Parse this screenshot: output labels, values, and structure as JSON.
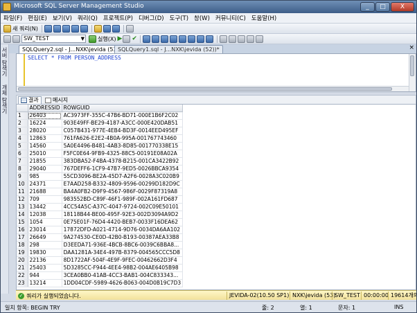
{
  "window": {
    "title": "Microsoft SQL Server Management Studio",
    "buttons": [
      "_",
      "□",
      "X"
    ]
  },
  "menu": [
    "파일(F)",
    "편집(E)",
    "보기(V)",
    "쿼리(Q)",
    "프로젝트(P)",
    "디버그(D)",
    "도구(T)",
    "창(W)",
    "커뮤니티(C)",
    "도움말(H)"
  ],
  "toolbar": {
    "new_query": "새 쿼리(N)",
    "database": "SW_TEST",
    "execute": "실행(X)"
  },
  "sidebar": {
    "tab1": "서버 탐색기",
    "tab2": "개체 탐색기"
  },
  "doc_tabs": [
    {
      "label": "SQLQuery2.sql - J...NXK\\jevida (53))*"
    },
    {
      "label": "SQLQuery1.sql - J...NXK\\jevida (52))*"
    }
  ],
  "editor": {
    "code": "SELECT * FROM PERSON_ADDRESS"
  },
  "result_tabs": {
    "results": "결과",
    "messages": "메시지"
  },
  "grid": {
    "columns": [
      "ADDRESSID",
      "ROWGUID"
    ],
    "rows": [
      [
        "1",
        "26403",
        "AC3973FF-355C-47B6-BD71-000E1B6F2C02"
      ],
      [
        "2",
        "16224",
        "903E49FF-BE29-4187-A3CC-000E420DAB51"
      ],
      [
        "3",
        "28020",
        "C057B431-977E-4EB4-BD3F-0014EED495EF"
      ],
      [
        "4",
        "12863",
        "761FA626-E2E2-4B0A-995A-001767743460"
      ],
      [
        "5",
        "14560",
        "5A0E4496-B481-4AB3-8D85-001770338E15"
      ],
      [
        "6",
        "25010",
        "F5FC0E64-9FB9-4325-88C5-00191E08A02A"
      ],
      [
        "7",
        "21855",
        "383DBA52-F4BA-4378-B215-001CA3422B92"
      ],
      [
        "8",
        "29040",
        "767DEFF6-1CF9-47B7-9ED5-0026BBCA9354"
      ],
      [
        "9",
        "985",
        "55CD3096-BE2A-45D7-A2F6-0028A3C020B9"
      ],
      [
        "10",
        "24371",
        "E7AAD258-B332-4809-9596-00299D182D9C"
      ],
      [
        "11",
        "21688",
        "BA4A0FB2-D9F9-4567-986F-0029F87319A8"
      ],
      [
        "12",
        "709",
        "983552BD-C89F-46F1-989F-002A161FD687"
      ],
      [
        "13",
        "13442",
        "4CC54A5C-A37C-4047-9724-002C09E50101"
      ],
      [
        "14",
        "12038",
        "18118B44-BE00-495F-92E3-002D3094A9D2"
      ],
      [
        "15",
        "1054",
        "0E75E01F-76D4-4420-BEB7-0033F16DEA62"
      ],
      [
        "16",
        "23014",
        "17872DFD-A021-4714-9D76-0034DA6AA102"
      ],
      [
        "17",
        "26649",
        "9A274530-CE0D-42B0-B193-00387AEA33B8"
      ],
      [
        "18",
        "298",
        "D3EEDA71-936E-4BCB-8BC6-0039C6BBA8..."
      ],
      [
        "19",
        "19830",
        "DAA1281A-34E4-497B-8379-004565CCC5D8"
      ],
      [
        "20",
        "22136",
        "8D1722AF-504F-4E9F-9FEC-00462662D3F4"
      ],
      [
        "21",
        "25403",
        "5D3285CC-F944-4EE4-98B2-004AE6405B98"
      ],
      [
        "22",
        "944",
        "3CEA0BB0-41AB-4CC3-BAB1-004C833343..."
      ],
      [
        "23",
        "13214",
        "1DD04CDF-5989-4626-B063-004D0B19C7D3"
      ]
    ]
  },
  "status": {
    "message": "쿼리가 실행되었습니다.",
    "server": "JEVIDA-02(10.50 SP1)",
    "user": "NXK\\jevida (53)",
    "db": "SW_TEST",
    "time": "00:00:00",
    "rows": "19614개의 행"
  },
  "bottom": {
    "ready": "일치 항목: BEGIN TRY",
    "line": "줄: 2",
    "col": "열: 1",
    "char": "문자: 1",
    "ins": "INS"
  }
}
